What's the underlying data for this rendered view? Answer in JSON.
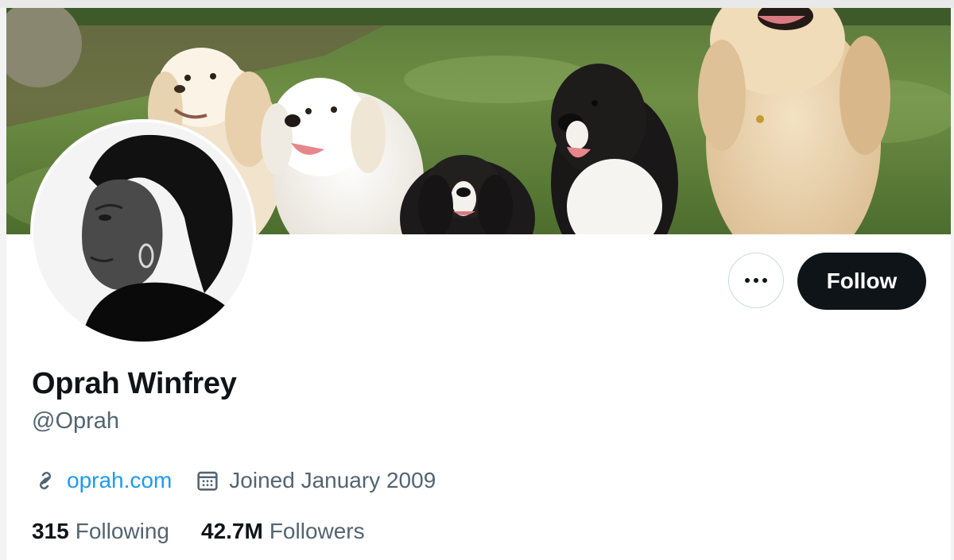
{
  "profile": {
    "display_name": "Oprah Winfrey",
    "handle": "@Oprah",
    "website": "oprah.com",
    "joined": "Joined January 2009",
    "following_count": "315",
    "following_label": "Following",
    "followers_count": "42.7M",
    "followers_label": "Followers"
  },
  "actions": {
    "follow_label": "Follow",
    "more_icon": "more-dots-icon"
  },
  "icons": {
    "website": "link-icon",
    "joined": "calendar-icon"
  },
  "colors": {
    "accent_link": "#1d9bf0",
    "follow_bg": "#0f1419",
    "secondary_text": "#536471"
  }
}
